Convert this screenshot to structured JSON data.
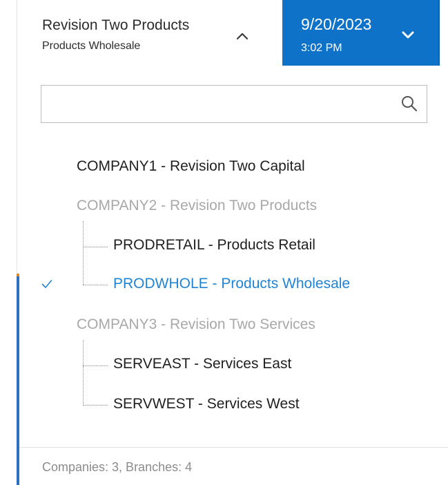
{
  "header": {
    "company_title": "Revision Two Products",
    "company_subtitle": "Products Wholesale",
    "date": "9/20/2023",
    "time": "3:02 PM"
  },
  "search": {
    "value": "",
    "placeholder": ""
  },
  "tree": {
    "company1": "COMPANY1 - Revision Two Capital",
    "company2": "COMPANY2 - Revision Two Products",
    "company2_branches": [
      "PRODRETAIL - Products Retail",
      "PRODWHOLE - Products Wholesale"
    ],
    "company3": "COMPANY3 - Revision Two Services",
    "company3_branches": [
      "SERVEAST - Services East",
      "SERVWEST - Services West"
    ],
    "selected_branch": "PRODWHOLE - Products Wholesale"
  },
  "footer": {
    "summary": "Companies: 3, Branches: 4"
  },
  "colors": {
    "accent": "#0f72c9",
    "selected_text": "#1f83d6",
    "dim_text": "#a8a8a8"
  },
  "icons": {
    "collapse": "chevron-up-icon",
    "date_dropdown": "chevron-down-icon",
    "search": "search-icon",
    "selected": "check-icon"
  }
}
